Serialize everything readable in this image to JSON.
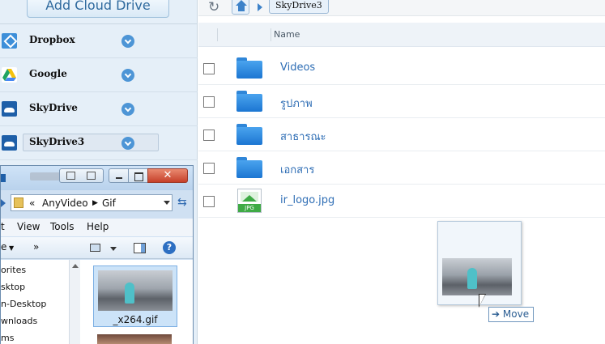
{
  "sidebar": {
    "add_button_label": "Add Cloud Drive",
    "drives": [
      {
        "label": "Dropbox",
        "icon": "dropbox-icon"
      },
      {
        "label": "Google",
        "icon": "google-drive-icon"
      },
      {
        "label": "SkyDrive",
        "icon": "skydrive-icon"
      },
      {
        "label": "SkyDrive3",
        "icon": "skydrive-icon",
        "selected": true
      }
    ]
  },
  "breadcrumb": {
    "current": "SkyDrive3"
  },
  "file_list": {
    "column_name": "Name",
    "rows": [
      {
        "name": "Videos",
        "type": "folder"
      },
      {
        "name": "รูปภาพ",
        "type": "folder"
      },
      {
        "name": "สาธารณะ",
        "type": "folder"
      },
      {
        "name": "เอกสาร",
        "type": "folder"
      },
      {
        "name": "ir_logo.jpg",
        "type": "jpg"
      }
    ],
    "jpg_badge": "JPG"
  },
  "explorer": {
    "close_label": "✕",
    "address": {
      "prefix": "«",
      "path": [
        "AnyVideo",
        "Gif"
      ]
    },
    "menu": [
      "t",
      "View",
      "Tools",
      "Help"
    ],
    "toolbar": {
      "left_label": "e",
      "more_label": "»",
      "help_label": "?"
    },
    "nav_items": [
      "orites",
      "sktop",
      "n-Desktop",
      "wnloads",
      "ms"
    ],
    "file": {
      "label": "_x264.gif"
    }
  },
  "drag": {
    "action_label": "Move"
  },
  "colors": {
    "accent": "#3d82c9",
    "sidebar_bg": "#e5eff8",
    "folder": "#2f86d8",
    "link_text": "#2f6eb5"
  }
}
